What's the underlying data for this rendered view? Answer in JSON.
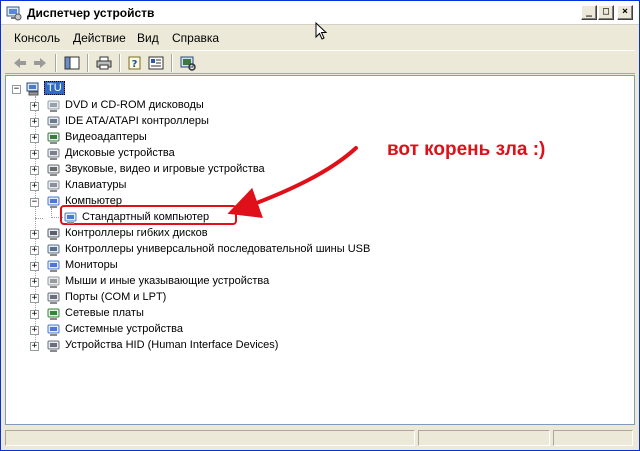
{
  "window": {
    "title": "Диспетчер устройств",
    "controls": {
      "minimize": "_",
      "maximize": "□",
      "close": "×"
    }
  },
  "menu": [
    "Консоль",
    "Действие",
    "Вид",
    "Справка"
  ],
  "toolbar": {
    "buttons": [
      "back-icon",
      "forward-icon",
      "show-hide-tree-icon",
      "print-icon",
      "help-properties-icon",
      "properties-icon",
      "scan-hardware-icon"
    ]
  },
  "tree": {
    "root": {
      "label": "TU",
      "expander": "−"
    },
    "items": [
      {
        "label": "DVD и CD-ROM дисководы",
        "expander": "+",
        "icon": "cdrom-icon"
      },
      {
        "label": "IDE ATA/ATAPI контроллеры",
        "expander": "+",
        "icon": "ide-controller-icon"
      },
      {
        "label": "Видеоадаптеры",
        "expander": "+",
        "icon": "display-adapter-icon"
      },
      {
        "label": "Дисковые устройства",
        "expander": "+",
        "icon": "disk-drive-icon"
      },
      {
        "label": "Звуковые, видео и игровые устройства",
        "expander": "+",
        "icon": "sound-icon"
      },
      {
        "label": "Клавиатуры",
        "expander": "+",
        "icon": "keyboard-icon"
      },
      {
        "label": "Компьютер",
        "expander": "−",
        "icon": "computer-icon"
      },
      {
        "label": "Стандартный компьютер",
        "expander": "",
        "icon": "computer-icon",
        "child": true
      },
      {
        "label": "Контроллеры гибких дисков",
        "expander": "+",
        "icon": "floppy-controller-icon"
      },
      {
        "label": "Контроллеры универсальной последовательной шины USB",
        "expander": "+",
        "icon": "usb-icon"
      },
      {
        "label": "Мониторы",
        "expander": "+",
        "icon": "monitor-icon"
      },
      {
        "label": "Мыши и иные указывающие устройства",
        "expander": "+",
        "icon": "mouse-icon"
      },
      {
        "label": "Порты (COM и LPT)",
        "expander": "+",
        "icon": "port-icon"
      },
      {
        "label": "Сетевые платы",
        "expander": "+",
        "icon": "network-card-icon"
      },
      {
        "label": "Системные устройства",
        "expander": "+",
        "icon": "system-device-icon"
      },
      {
        "label": "Устройства HID (Human Interface Devices)",
        "expander": "+",
        "icon": "hid-icon"
      }
    ]
  },
  "annotation": {
    "text": "вот корень зла :)",
    "color": "#e0101a"
  },
  "colors": {
    "selection": "#316ac5",
    "accent_red": "#e0101a"
  }
}
